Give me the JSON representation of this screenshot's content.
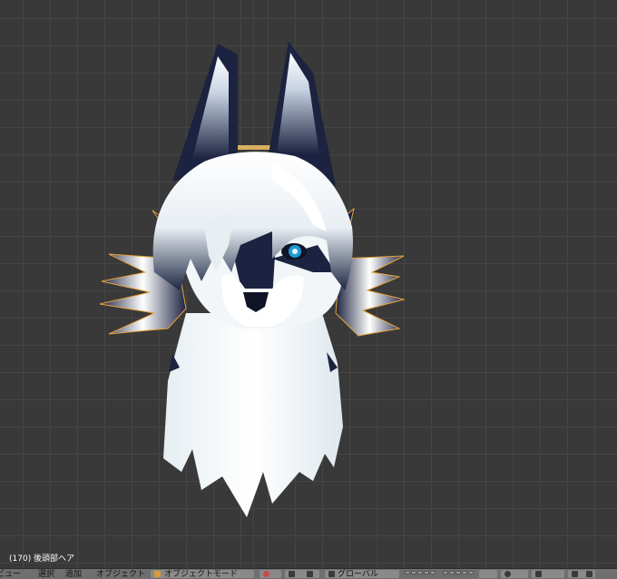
{
  "viewport": {
    "object_info": "(170) 後頭部ヘア"
  },
  "header": {
    "menu_view": "ビュー",
    "menu_select": "選択",
    "menu_add": "追加",
    "menu_object": "オブジェクト",
    "mode_label": "オブジェクトモード",
    "orientation_label": "グローバル"
  },
  "colors": {
    "grid": "#454545",
    "background": "#393939",
    "selection_outline": "#e8a33a",
    "fur_dark": "#1c2340",
    "eye": "#1f9ad6"
  }
}
